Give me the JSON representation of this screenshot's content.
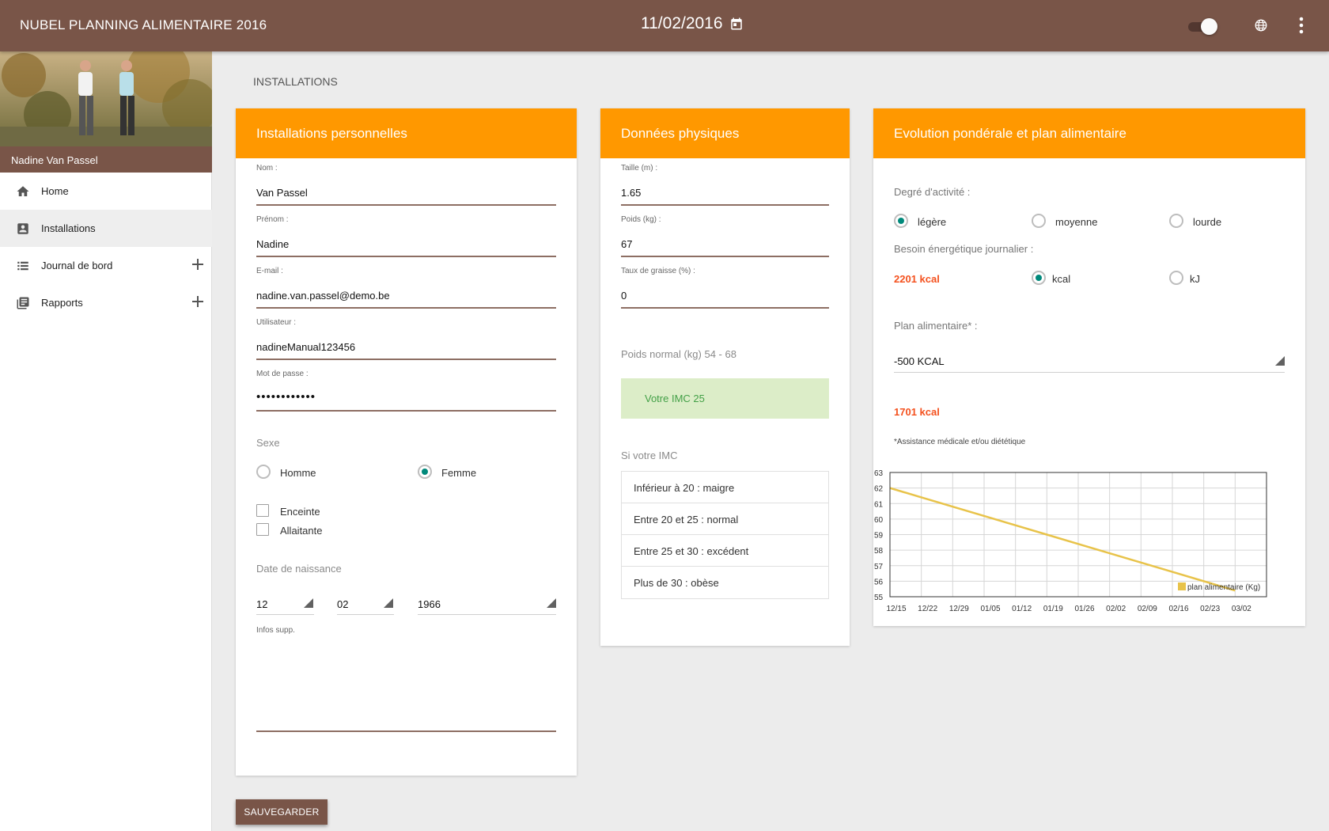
{
  "app": {
    "title": "NUBEL PLANNING ALIMENTAIRE 2016",
    "date": "11/02/2016"
  },
  "sidebar": {
    "user_name": "Nadine Van Passel",
    "items": [
      {
        "label": "Home",
        "icon": "home-icon"
      },
      {
        "label": "Installations",
        "icon": "contact-card-icon"
      },
      {
        "label": "Journal de bord",
        "icon": "list-icon"
      },
      {
        "label": "Rapports",
        "icon": "reports-icon"
      }
    ]
  },
  "page": {
    "heading": "INSTALLATIONS"
  },
  "personal": {
    "title": "Installations personnelles",
    "nom_label": "Nom :",
    "nom": "Van Passel",
    "prenom_label": "Prénom :",
    "prenom": "Nadine",
    "email_label": "E-mail :",
    "email": "nadine.van.passel@demo.be",
    "user_label": "Utilisateur :",
    "user": "nadineManual123456",
    "password_label": "Mot de passe :",
    "password": "••••••••••••",
    "sexe_label": "Sexe",
    "homme": "Homme",
    "femme": "Femme",
    "sexe_selected": "Femme",
    "enceinte": "Enceinte",
    "allaitante": "Allaitante",
    "birth_label": "Date de naissance",
    "birth_day": "12",
    "birth_month": "02",
    "birth_year": "1966",
    "infos_label": "Infos supp."
  },
  "physical": {
    "title": "Données physiques",
    "taille_label": "Taille (m) :",
    "taille": "1.65",
    "poids_label": "Poids (kg) :",
    "poids": "67",
    "graisse_label": "Taux de graisse (%) :",
    "graisse": "0",
    "normal_weight": "Poids normal (kg) 54 - 68",
    "imc": "Votre IMC 25",
    "si_label": "Si votre IMC",
    "imc_rows": [
      "Inférieur à 20 : maigre",
      "Entre 20 et 25 : normal",
      "Entre 25 et 30 : excédent",
      "Plus de 30 : obèse"
    ]
  },
  "evolution": {
    "title": "Evolution pondérale et plan alimentaire",
    "activity_label": "Degré d'activité :",
    "activity_options": [
      "légère",
      "moyenne",
      "lourde"
    ],
    "activity_selected": "légère",
    "energy_label": "Besoin énergétique journalier :",
    "energy_value": "2201 kcal",
    "unit_options": [
      "kcal",
      "kJ"
    ],
    "unit_selected": "kcal",
    "plan_label": "Plan alimentaire* :",
    "plan_value": "-500 KCAL",
    "plan_result": "1701 kcal",
    "note": "*Assistance médicale et/ou diététique"
  },
  "chart_data": {
    "type": "line",
    "x": [
      "12/15",
      "12/22",
      "12/29",
      "01/05",
      "01/12",
      "01/19",
      "01/26",
      "02/02",
      "02/09",
      "02/16",
      "02/23",
      "03/02"
    ],
    "series": [
      {
        "name": "plan alimentaire (Kg)",
        "values": [
          62.0,
          61.4,
          60.8,
          60.2,
          59.6,
          59.0,
          58.4,
          57.8,
          57.2,
          56.6,
          56.0,
          55.4
        ],
        "color": "#e8c34a"
      }
    ],
    "ylim": [
      55,
      63
    ],
    "yticks": [
      "55",
      "56",
      "57",
      "58",
      "59",
      "60",
      "61",
      "62",
      "63"
    ],
    "grid": true,
    "legend": "bottom-right"
  },
  "actions": {
    "save": "SAUVEGARDER"
  },
  "colors": {
    "brown": "#795548",
    "orange": "#ff9800",
    "teal": "#00897b",
    "red": "#f4511e",
    "green": "#43a047"
  }
}
